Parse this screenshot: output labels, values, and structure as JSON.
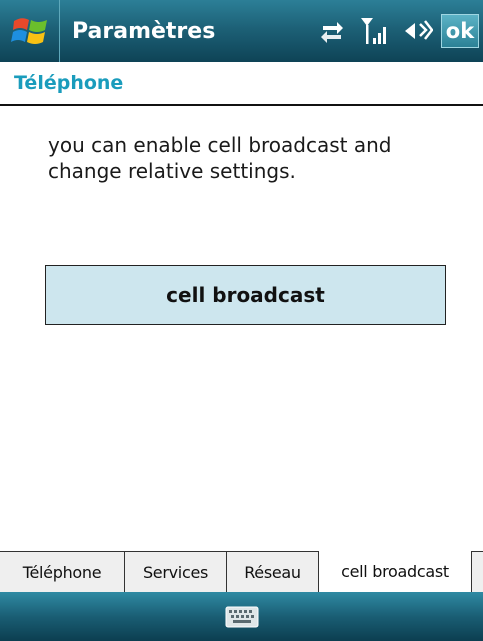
{
  "titlebar": {
    "title": "Paramètres",
    "ok_label": "ok",
    "icons": [
      "windows-start-icon",
      "data-connection-icon",
      "signal-strength-icon",
      "volume-icon"
    ]
  },
  "section": {
    "header": "Téléphone"
  },
  "main": {
    "description": "you can enable cell broadcast and change relative settings.",
    "button_label": "cell broadcast"
  },
  "tabs": [
    {
      "label": "Téléphone",
      "active": false
    },
    {
      "label": "Services",
      "active": false
    },
    {
      "label": "Réseau",
      "active": false
    },
    {
      "label": "cell broadcast",
      "active": true
    }
  ],
  "bottombar": {
    "icon": "keyboard-icon"
  },
  "colors": {
    "titlebar": "#1d6177",
    "header_text": "#1a9cbc",
    "button_bg": "#cde6ee"
  }
}
